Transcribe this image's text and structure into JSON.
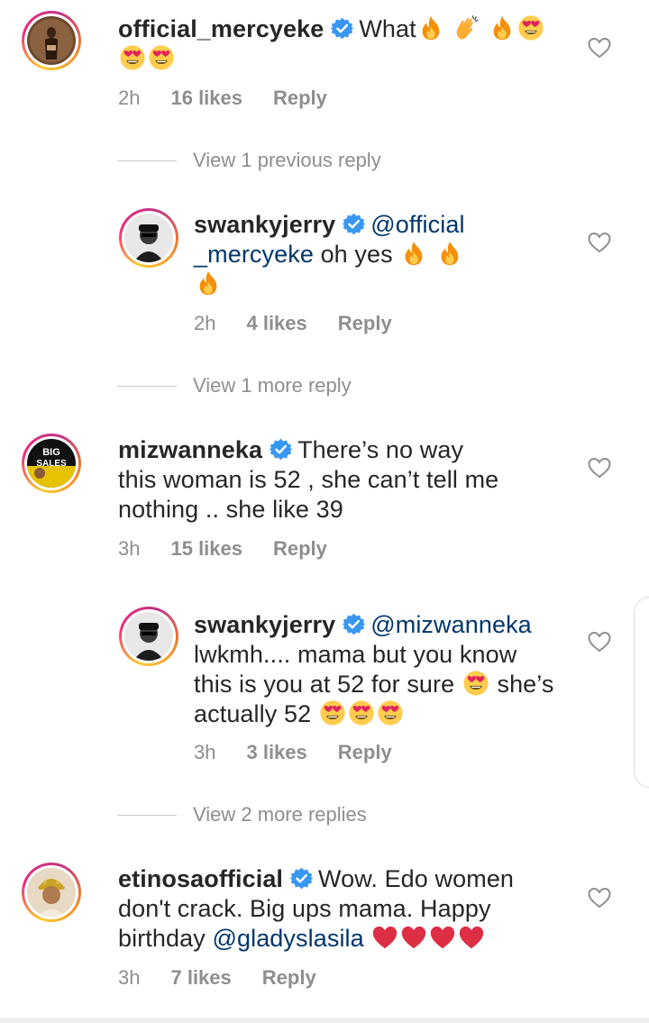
{
  "comments": [
    {
      "username": "official_mercyeke",
      "text_before": "What",
      "time": "2h",
      "likes": "16 likes",
      "reply": "Reply"
    },
    {
      "username": "swankyjerry",
      "mention": "@official _mercyeke",
      "mention_line1": "@official",
      "mention_line2": "_mercyeke",
      "text": "oh yes",
      "time": "2h",
      "likes": "4 likes",
      "reply": "Reply"
    },
    {
      "username": "mizwanneka",
      "line1": "There’s no way",
      "line2": "this woman is 52 , she can’t tell me",
      "line3": "nothing .. she like 39",
      "time": "3h",
      "likes": "15 likes",
      "reply": "Reply"
    },
    {
      "username": "swankyjerry",
      "mention": "@mizwanneka",
      "line2": "lwkmh.... mama but you know",
      "line3a": "this is you at 52 for sure",
      "line3b": "she’s",
      "line4": "actually 52",
      "time": "3h",
      "likes": "3 likes",
      "reply": "Reply"
    },
    {
      "username": "etinosaofficial",
      "line1": "Wow. Edo women",
      "line2": "don't crack. Big ups mama. Happy",
      "line3a": "birthday",
      "mention": "@gladyslasila",
      "time": "3h",
      "likes": "7 likes",
      "reply": "Reply"
    }
  ],
  "view_replies": {
    "previous": "View 1 previous reply",
    "more1": "View 1 more reply",
    "more2": "View 2 more replies"
  },
  "icons": {
    "verified": "verified-badge-icon",
    "heart": "heart-outline-icon",
    "fire": "fire-emoji",
    "clap": "clapping-hands-emoji",
    "heart_eyes": "heart-eyes-emoji",
    "red_heart": "red-heart-emoji"
  },
  "colors": {
    "verified_blue": "#3897f0",
    "mention": "#00376b",
    "meta_gray": "#8e8e8e"
  }
}
